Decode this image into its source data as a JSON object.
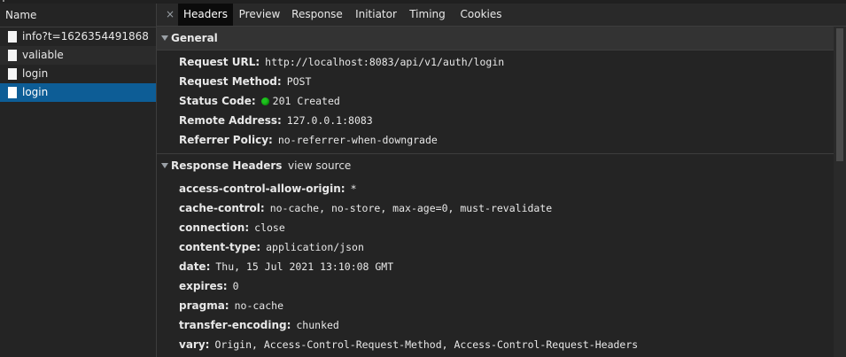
{
  "left": {
    "header": "Name",
    "requests": [
      {
        "name": "info?t=1626354491868"
      },
      {
        "name": "valiable"
      },
      {
        "name": "login"
      },
      {
        "name": "login"
      }
    ]
  },
  "tabs": {
    "close": "×",
    "items": [
      "Headers",
      "Preview",
      "Response",
      "Initiator",
      "Timing",
      "Cookies"
    ]
  },
  "general": {
    "title": "General",
    "rows": [
      {
        "key": "Request URL:",
        "value": "http://localhost:8083/api/v1/auth/login"
      },
      {
        "key": "Request Method:",
        "value": "POST"
      },
      {
        "key": "Status Code:",
        "value": "201 Created"
      },
      {
        "key": "Remote Address:",
        "value": "127.0.0.1:8083"
      },
      {
        "key": "Referrer Policy:",
        "value": "no-referrer-when-downgrade"
      }
    ]
  },
  "response_headers": {
    "title": "Response Headers",
    "view_source": "view source",
    "rows": [
      {
        "key": "access-control-allow-origin:",
        "value": "*"
      },
      {
        "key": "cache-control:",
        "value": "no-cache, no-store, max-age=0, must-revalidate"
      },
      {
        "key": "connection:",
        "value": "close"
      },
      {
        "key": "content-type:",
        "value": "application/json"
      },
      {
        "key": "date:",
        "value": "Thu, 15 Jul 2021 13:10:08 GMT"
      },
      {
        "key": "expires:",
        "value": "0"
      },
      {
        "key": "pragma:",
        "value": "no-cache"
      },
      {
        "key": "transfer-encoding:",
        "value": "chunked"
      },
      {
        "key": "vary:",
        "value": "Origin, Access-Control-Request-Method, Access-Control-Request-Headers"
      }
    ]
  },
  "colors": {
    "selected_row": "#0d5d96",
    "status_ok": "#1ec41e",
    "background": "#242424"
  }
}
